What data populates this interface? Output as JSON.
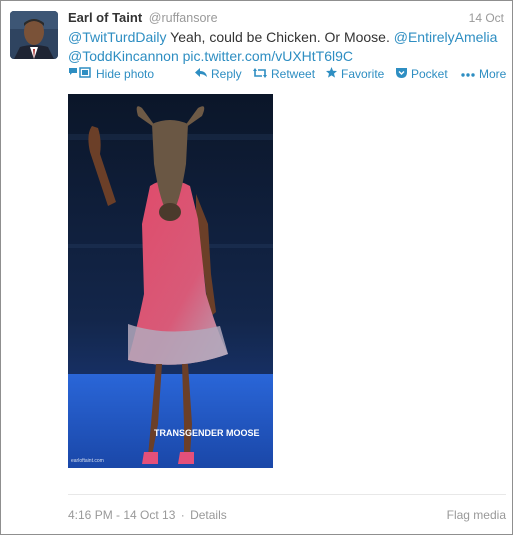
{
  "tweet": {
    "author_name": "Earl of Taint",
    "author_handle": "@ruffansore",
    "date": "14 Oct",
    "text_parts": {
      "mention1": "@TwitTurdDaily",
      "body": " Yeah, could be Chicken. Or Moose. ",
      "mention2": "@EntirelyAmelia",
      "mention3": "@ToddKincannon",
      "space": " ",
      "pic_link": "pic.twitter.com/vUXHtT6l9C"
    }
  },
  "actions": {
    "hide_photo": "Hide photo",
    "reply": "Reply",
    "retweet": "Retweet",
    "favorite": "Favorite",
    "pocket": "Pocket",
    "more": "More"
  },
  "photo": {
    "caption": "TRANSGENDER MOOSE",
    "watermark": "earloftaint.com"
  },
  "footer": {
    "timestamp": "4:16 PM - 14 Oct 13",
    "separator": "·",
    "details": "Details",
    "flag_media": "Flag media"
  },
  "colors": {
    "link": "#2e8ec2",
    "muted": "#999999",
    "text": "#333333"
  },
  "icons": [
    "media-icon",
    "reply-icon",
    "retweet-icon",
    "favorite-icon",
    "pocket-icon",
    "more-icon"
  ]
}
